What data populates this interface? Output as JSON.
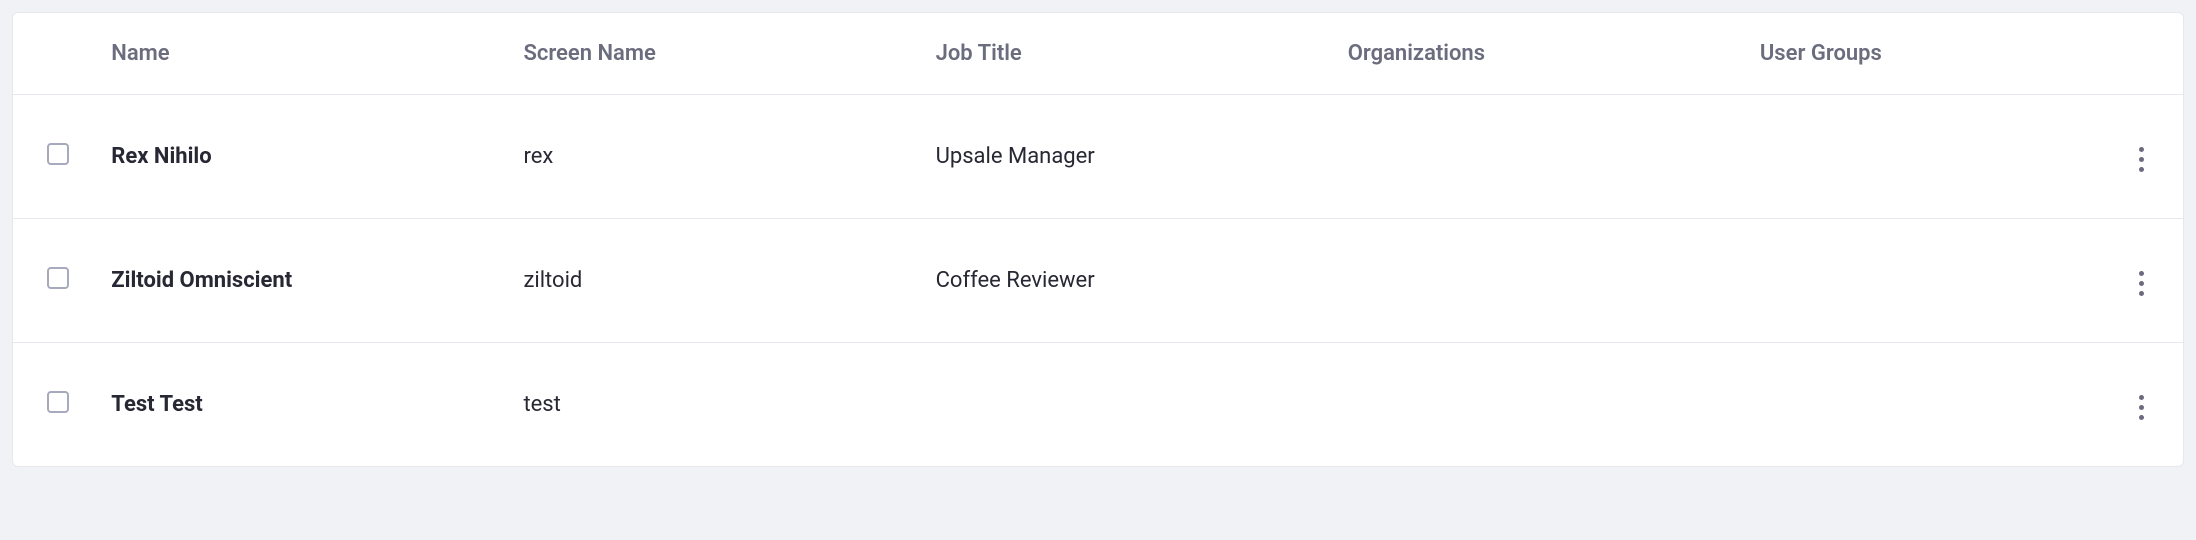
{
  "table": {
    "headers": {
      "name": "Name",
      "screen_name": "Screen Name",
      "job_title": "Job Title",
      "organizations": "Organizations",
      "user_groups": "User Groups"
    },
    "rows": [
      {
        "name": "Rex Nihilo",
        "screen_name": "rex",
        "job_title": "Upsale Manager",
        "organizations": "",
        "user_groups": ""
      },
      {
        "name": "Ziltoid Omniscient",
        "screen_name": "ziltoid",
        "job_title": "Coffee Reviewer",
        "organizations": "",
        "user_groups": ""
      },
      {
        "name": "Test Test",
        "screen_name": "test",
        "job_title": "",
        "organizations": "",
        "user_groups": ""
      }
    ]
  }
}
